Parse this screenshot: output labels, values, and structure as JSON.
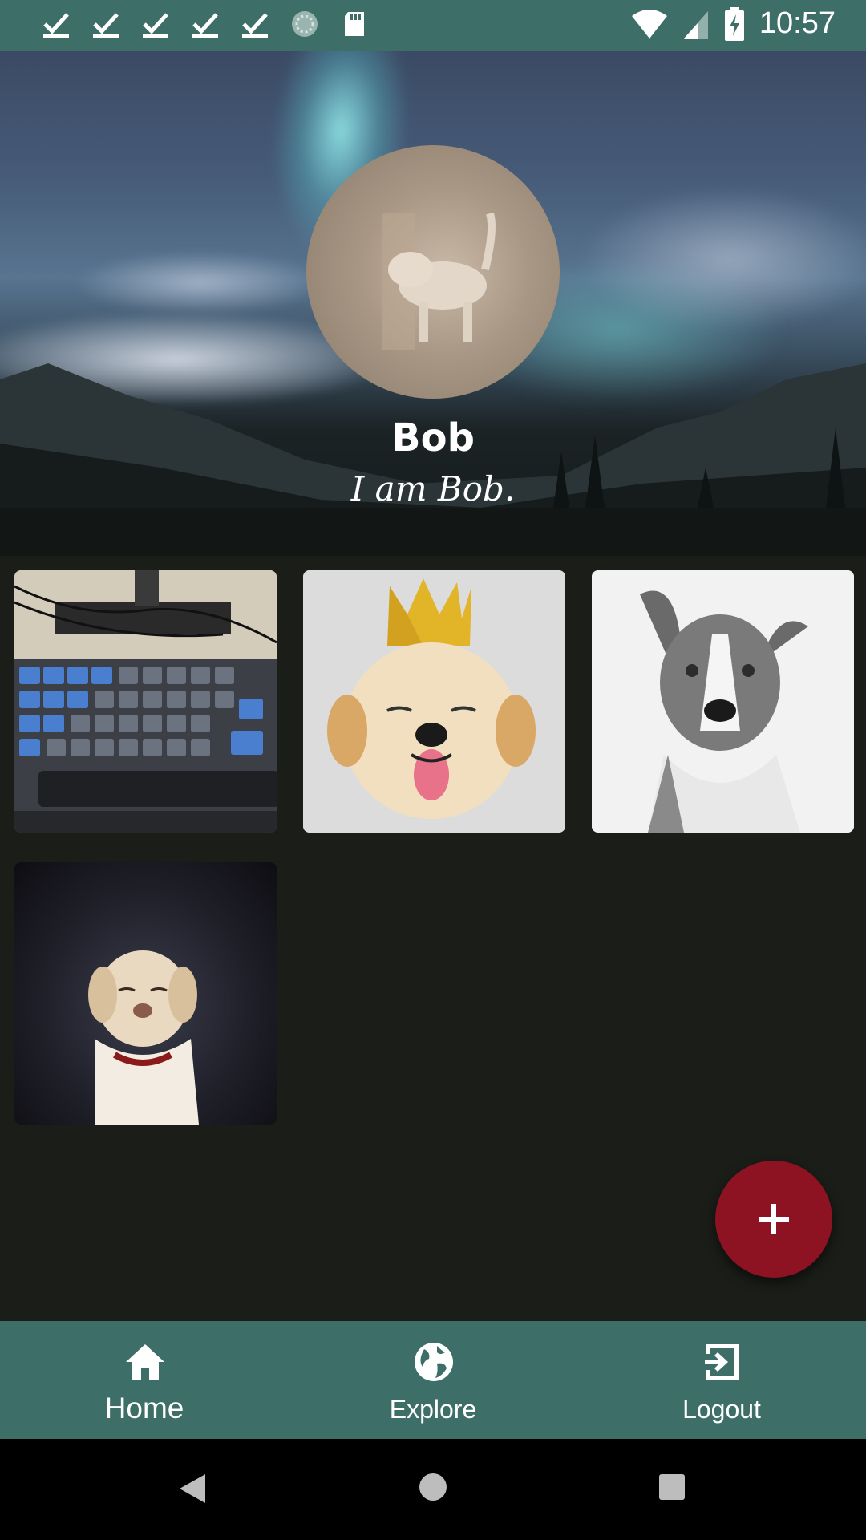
{
  "status_bar": {
    "left_icons": [
      "check-icon",
      "check-icon",
      "check-icon",
      "check-icon",
      "check-icon",
      "sync-icon",
      "sd-card-icon"
    ],
    "right_icons": [
      "wifi-icon",
      "signal-icon",
      "battery-charging-icon"
    ],
    "time": "10:57"
  },
  "profile": {
    "name": "Bob",
    "bio": "I am Bob."
  },
  "photos": [
    {
      "subject": "keyboard"
    },
    {
      "subject": "puppy with crown"
    },
    {
      "subject": "gray and white dog"
    },
    {
      "subject": "labrador"
    }
  ],
  "fab": {
    "icon": "plus-icon"
  },
  "bottom_nav": {
    "items": [
      {
        "label": "Home",
        "icon": "home-icon",
        "active": true
      },
      {
        "label": "Explore",
        "icon": "globe-icon"
      },
      {
        "label": "Logout",
        "icon": "logout-icon"
      }
    ]
  },
  "colors": {
    "primary": "#3d6f68",
    "accent": "#8e1322",
    "background": "#1b1d18"
  }
}
